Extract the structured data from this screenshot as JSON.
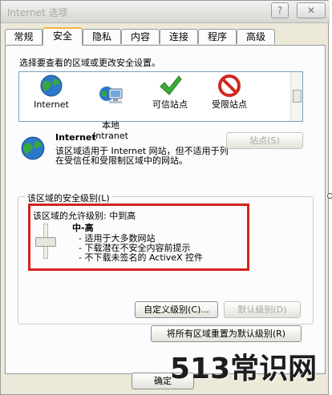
{
  "window": {
    "title": "Internet 选项",
    "help_label": "?",
    "close_label": "✕"
  },
  "tabs": [
    "常规",
    "安全",
    "隐私",
    "内容",
    "连接",
    "程序",
    "高级"
  ],
  "active_tab": "安全",
  "prompt": "选择要查看的区域或更改安全设置。",
  "zones": [
    {
      "label": "Internet",
      "icon": "globe-icon"
    },
    {
      "label": "本地\nIntranet",
      "icon": "intranet-icon"
    },
    {
      "label": "可信站点",
      "icon": "check-icon"
    },
    {
      "label": "受限站点",
      "icon": "restricted-icon"
    }
  ],
  "selected_zone": {
    "name": "Internet",
    "description": "该区域适用于 Internet 网站，但不适用于列在受信任和受限制区域中的网站。",
    "sites_button": "站点(S)"
  },
  "security_level": {
    "group_label": "该区域的安全级别(L)",
    "allowed_label": "该区域的允许级别: 中到高",
    "level_name": "中-高",
    "bullets": [
      "- 适用于大多数网站",
      "- 下载潜在不安全内容前提示",
      "- 不下载未签名的 ActiveX 控件"
    ]
  },
  "buttons": {
    "custom": "自定义级别(C)...",
    "default": "默认级别(D)",
    "reset_all": "将所有区域重置为默认级别(R)",
    "ok": "确定"
  },
  "watermark": "513常识网",
  "colors": {
    "highlight": "#d4231c",
    "tab_accent": "#f8b33d"
  }
}
